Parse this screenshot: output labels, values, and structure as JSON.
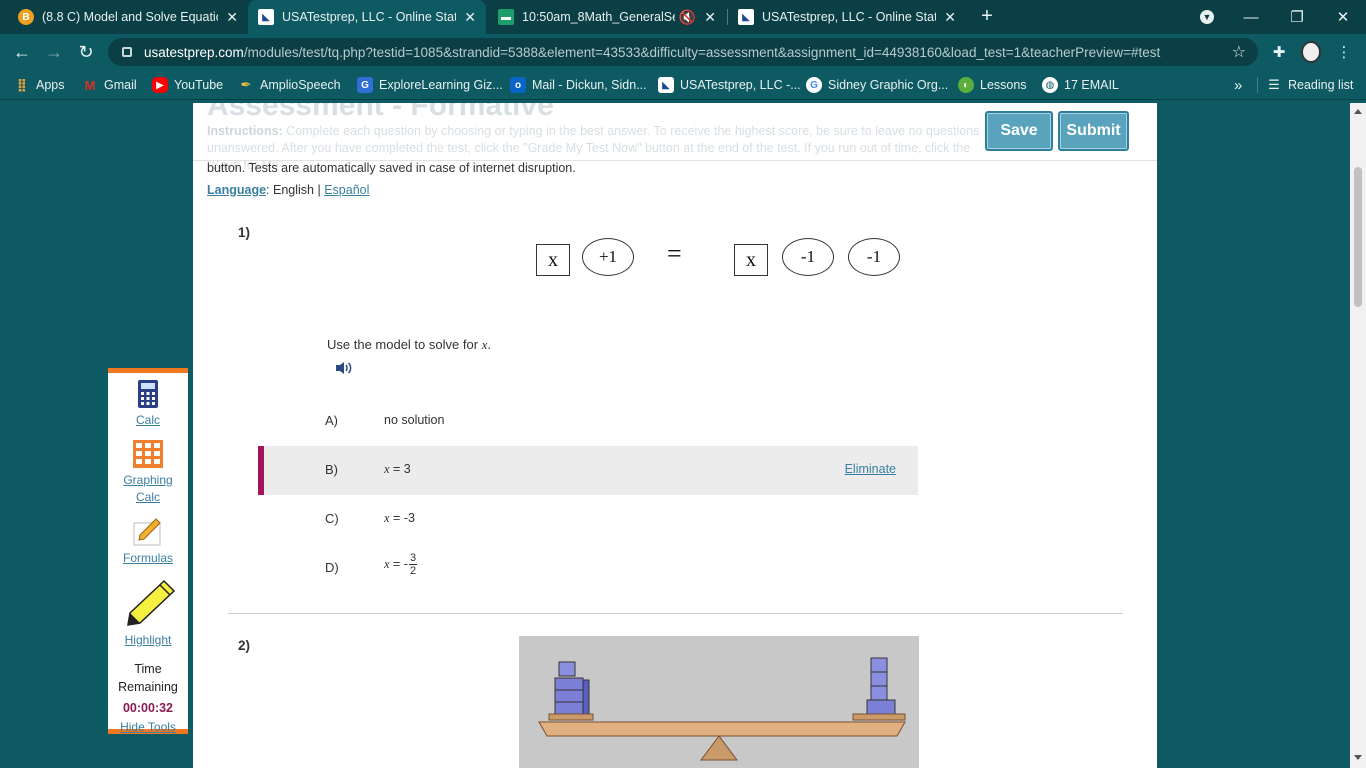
{
  "browser": {
    "tabs": [
      {
        "title": "(8.8 C) Model and Solve Equation",
        "active": false,
        "icon": "brainpop-favicon",
        "icon_color": "#f0a020"
      },
      {
        "title": "USATestprep, LLC - Online State-",
        "active": true,
        "icon": "usatestprep-favicon",
        "icon_color": "#ffffff"
      },
      {
        "title": "10:50am_8Math_GeneralSess",
        "active": false,
        "icon": "meet-favicon",
        "icon_color": "#1e9e6a"
      },
      {
        "title": "USATestprep, LLC - Online State-",
        "active": false,
        "icon": "usatestprep-favicon",
        "icon_color": "#ffffff"
      }
    ],
    "url_host": "usatestprep.com",
    "url_path": "/modules/test/tq.php?testid=1085&strandid=5388&element=43533&difficulty=assessment&assignment_id=44938160&load_test=1&teacherPreview=#test",
    "bookmarks": [
      {
        "label": "Apps",
        "icon": "apps-grid-icon",
        "color": "#e8a33a"
      },
      {
        "label": "Gmail",
        "icon": "gmail-icon",
        "color": "#d93025"
      },
      {
        "label": "YouTube",
        "icon": "youtube-icon",
        "color": "#ff0000"
      },
      {
        "label": "AmplioSpeech",
        "icon": "feather-icon",
        "color": "#f0c040"
      },
      {
        "label": "ExploreLearning Giz...",
        "icon": "gizmos-icon",
        "color": "#2f6fd6"
      },
      {
        "label": "Mail - Dickun, Sidn...",
        "icon": "outlook-icon",
        "color": "#0a64c8"
      },
      {
        "label": "USATestprep, LLC -...",
        "icon": "usatestprep-favicon",
        "color": "#ffffff"
      },
      {
        "label": "Sidney Graphic Org...",
        "icon": "google-icon",
        "color": "#ffffff"
      },
      {
        "label": "Lessons",
        "icon": "lessons-icon",
        "color": "#5cae3c"
      },
      {
        "label": "17 EMAIL",
        "icon": "globe-icon",
        "color": "#ffffff"
      }
    ],
    "more_label": "»",
    "reading_list_label": "Reading list"
  },
  "header": {
    "faded_title": "Assessment - Formative",
    "faded_instructions_label": "Instructions:",
    "faded_instructions_text": "Complete each question by choosing or typing in the best answer. To receive the highest score, be sure to leave no questions unanswered. After you have completed the test, click the \"Grade My Test Now\" button at the end of the test. If you run out of time, click the \"Save for Me\"",
    "instructions_tail": "button. Tests are automatically saved in case of internet disruption.",
    "save_label": "Save",
    "submit_label": "Submit",
    "language_label": "Language",
    "language_current": "English",
    "language_separator": "|",
    "language_alt": "Español"
  },
  "question1": {
    "number": "1)",
    "model_left": [
      "x",
      "+1"
    ],
    "equals": "=",
    "model_right": [
      "x",
      "-1",
      "-1"
    ],
    "prompt_prefix": "Use the model to solve for ",
    "prompt_var": "x",
    "prompt_suffix": ".",
    "choices": [
      {
        "letter": "A)",
        "answer": "no solution",
        "selected": false
      },
      {
        "letter": "B)",
        "var": "x",
        "rhs": " = 3",
        "selected": true
      },
      {
        "letter": "C)",
        "var": "x",
        "rhs": " = -3",
        "selected": false
      },
      {
        "letter": "D)",
        "var": "x",
        "rhs": " = -",
        "frac_num": "3",
        "frac_den": "2",
        "selected": false
      }
    ],
    "eliminate_label": "Eliminate"
  },
  "question2": {
    "number": "2)"
  },
  "tools": {
    "calc": "Calc",
    "graphing_calc_line1": "Graphing",
    "graphing_calc_line2": "Calc",
    "formulas": "Formulas",
    "highlight": "Highlight",
    "time_label_line1": "Time",
    "time_label_line2": "Remaining",
    "time_value": "00:00:32",
    "hide_tools": "Hide Tools"
  }
}
